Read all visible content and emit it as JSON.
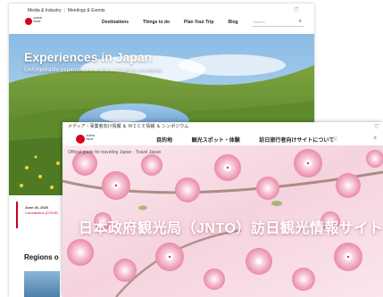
{
  "back_page": {
    "utility": {
      "item1": "Media & Industry",
      "item2": "Meetings & Events"
    },
    "logo_text": "JAPAN\nTOURISM",
    "nav": [
      "Destinations",
      "Things to do",
      "Plan Your Trip",
      "Blog"
    ],
    "search_placeholder": "Search",
    "hero_title": "Experiences in Japan",
    "hero_subtitle": "Unforgettable experiences and breathtaking moments",
    "news_date": "June 20, 2020",
    "news_title": "Coronavirus (COVID",
    "regions_title": "Regions o"
  },
  "front_page": {
    "utility": "メディア・事業者向け情報 ＆ ＭＩＣＥ情報 ＆ シンポジウム",
    "logo_text": "JAPAN\nTOURISM",
    "nav": [
      "目的地",
      "観光スポット・体験",
      "訪日旅行者向けサイトについて"
    ],
    "search_placeholder": "検索",
    "tagline": "Official guide for traveling Japan - Travel Japan",
    "hero_title": "日本政府観光局（JNTO）訪日観光情報サイト"
  },
  "colors": {
    "brand_red": "#d7001f",
    "accent_red": "#c4001e"
  },
  "icons": {
    "favorite": "heart-icon",
    "search": "search-icon"
  }
}
